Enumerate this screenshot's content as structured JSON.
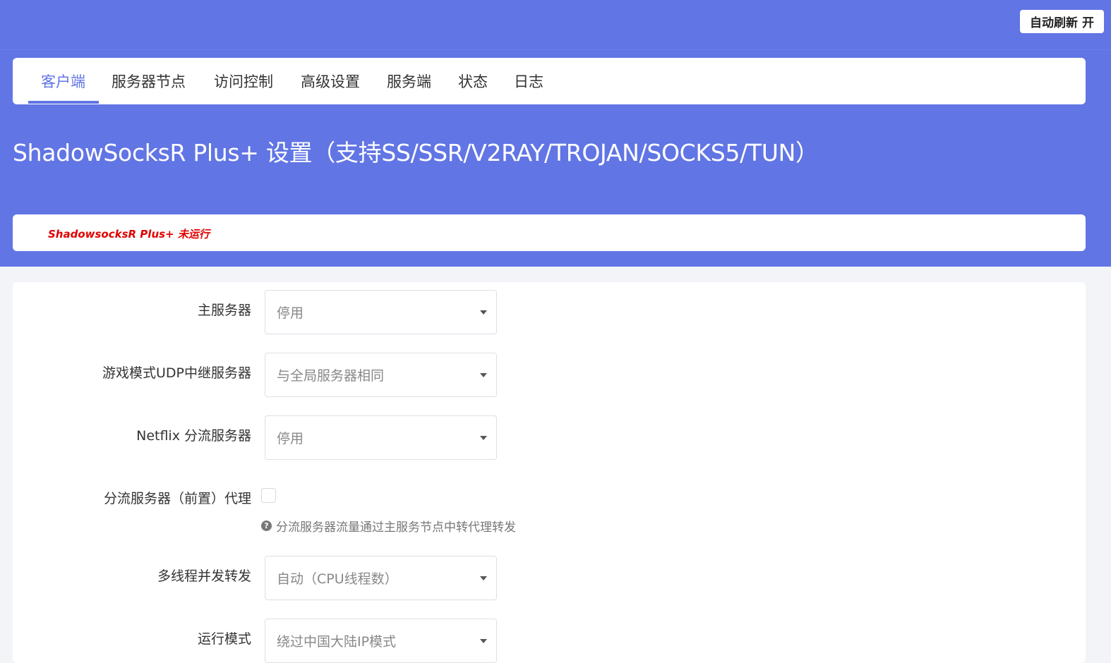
{
  "topbar": {
    "auto_refresh_label": "自动刷新 开"
  },
  "tabs": [
    {
      "label": "客户端",
      "active": true
    },
    {
      "label": "服务器节点"
    },
    {
      "label": "访问控制"
    },
    {
      "label": "高级设置"
    },
    {
      "label": "服务端"
    },
    {
      "label": "状态"
    },
    {
      "label": "日志"
    }
  ],
  "page": {
    "title": "ShadowSocksR Plus+ 设置（支持SS/SSR/V2RAY/TROJAN/SOCKS5/TUN）",
    "status": "ShadowsocksR Plus+ 未运行"
  },
  "form": {
    "main_server": {
      "label": "主服务器",
      "value": "停用"
    },
    "udp_relay": {
      "label": "游戏模式UDP中继服务器",
      "value": "与全局服务器相同"
    },
    "netflix": {
      "label": "Netflix 分流服务器",
      "value": "停用"
    },
    "shunt_proxy": {
      "label": "分流服务器（前置）代理",
      "checked": false,
      "help": "分流服务器流量通过主服务节点中转代理转发"
    },
    "threads": {
      "label": "多线程并发转发",
      "value": "自动（CPU线程数）"
    },
    "run_mode": {
      "label": "运行模式",
      "value": "绕过中国大陆IP模式"
    }
  },
  "colors": {
    "header_bg": "#6175e4",
    "accent": "#6175e4",
    "status_red": "#e00000",
    "page_bg": "#f3f4f8"
  }
}
